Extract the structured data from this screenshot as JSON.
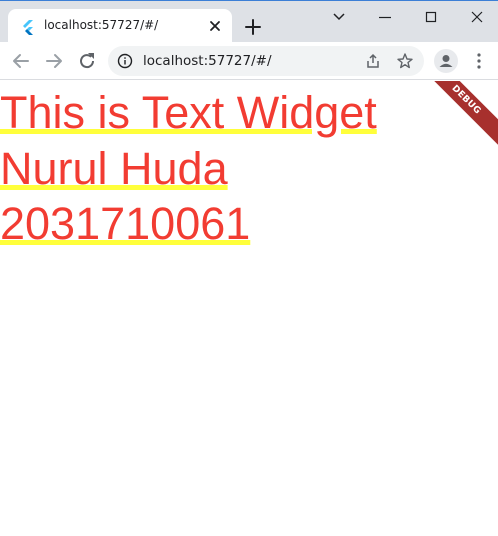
{
  "tab": {
    "title": "localhost:57727/#/"
  },
  "toolbar": {
    "url": "localhost:57727/#/"
  },
  "content": {
    "lines": [
      "This is Text Widget",
      "Nurul Huda",
      "2031710061"
    ],
    "text_color": "#f23c32",
    "underline_color": "#ffff3b"
  },
  "debug_banner": {
    "label": "DEBUG",
    "color": "#a7302d"
  }
}
